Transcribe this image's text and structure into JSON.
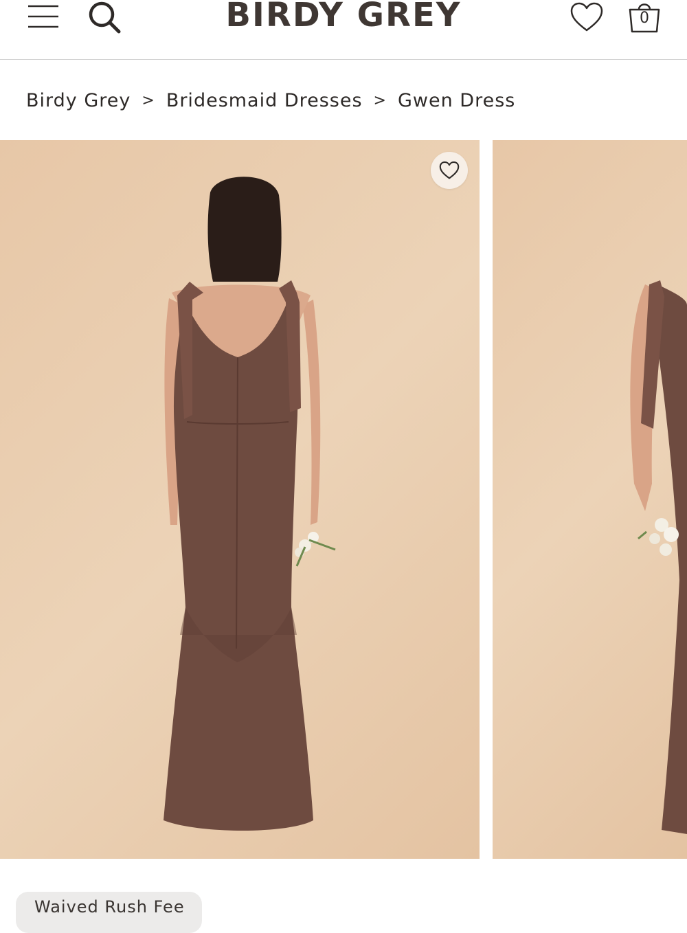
{
  "header": {
    "logo": "BIRDY GREY",
    "cart_count": "0",
    "icons": [
      "hamburger-menu-icon",
      "search-icon",
      "heart-icon",
      "shopping-bag-icon"
    ]
  },
  "breadcrumb": {
    "items": [
      "Birdy Grey",
      "Bridesmaid Dresses",
      "Gwen Dress"
    ],
    "separator": ">"
  },
  "gallery": {
    "favorite_icon": "heart-outline-icon"
  },
  "badge": {
    "label": "Waived Rush Fee"
  },
  "colors": {
    "brand_text": "#3f3733",
    "backdrop": "#e9cdb0",
    "dress": "#6e4b40",
    "badge_bg": "#ecebea"
  }
}
